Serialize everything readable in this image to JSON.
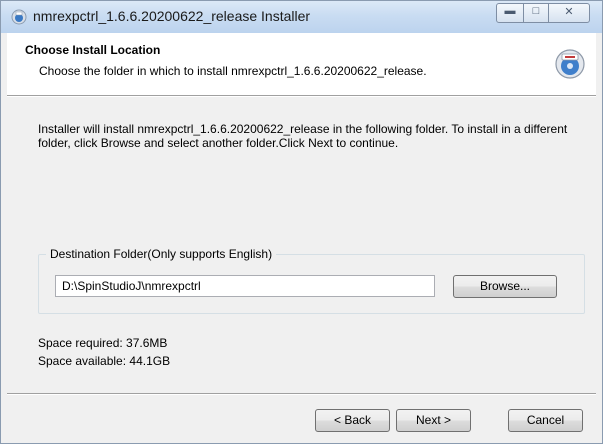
{
  "window": {
    "title": "nmrexpctrl_1.6.6.20200622_release Installer",
    "controls": {
      "minimize": "minimize",
      "maximize": "maximize",
      "close": "close"
    }
  },
  "header": {
    "title": "Choose Install Location",
    "subtitle": "Choose the folder in which to install nmrexpctrl_1.6.6.20200622_release.",
    "icon": "installer-disk-icon"
  },
  "body": {
    "description": "Installer will install nmrexpctrl_1.6.6.20200622_release in the following folder. To install in a different folder, click Browse and select another folder.Click Next to continue.",
    "destination": {
      "label": "Destination Folder(Only supports English)",
      "value": "D:\\SpinStudioJ\\nmrexpctrl",
      "browse_label": "Browse..."
    },
    "space_required": "Space required: 37.6MB",
    "space_available": "Space available: 44.1GB"
  },
  "footer": {
    "back_label": "< Back",
    "next_label": "Next >",
    "cancel_label": "Cancel"
  },
  "colors": {
    "titlebar": "#c9dcf2",
    "dialog_bg": "#f0f0f0",
    "header_bg": "#ffffff",
    "groupbox_border": "#d5dfe5"
  }
}
